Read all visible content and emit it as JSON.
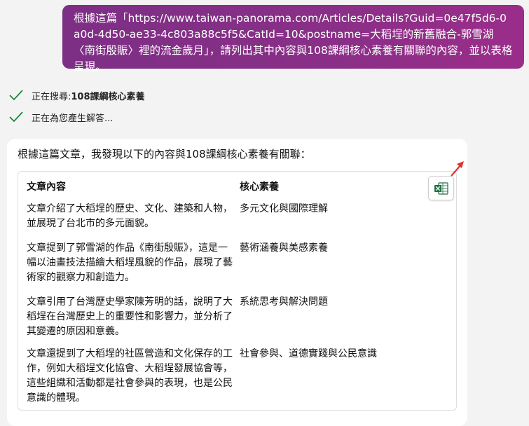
{
  "user_message": "根據這篇「https://www.taiwan-panorama.com/Articles/Details?Guid=0e47f5d6-0a0d-4d50-ae33-4c803a88c5f5&CatId=10&postname=大稻埕的新舊融合-郭雪湖〈南街殷賑〉裡的流金歲月」，請列出其中內容與108課綱核心素養有關聯的內容，並以表格呈現。",
  "status": {
    "searching_prefix": "正在搜尋: ",
    "searching_query": "108課綱核心素養",
    "generating": "正在為您產生解答..."
  },
  "response": {
    "intro": "根據這篇文章，我發現以下的內容與108課綱核心素養有關聯：",
    "table": {
      "headers": [
        "文章內容",
        "核心素養"
      ],
      "rows": [
        {
          "content": "文章介紹了大稻埕的歷史、文化、建築和人物，並展現了台北市的多元面貌。",
          "literacy": "多元文化與國際理解"
        },
        {
          "content": "文章提到了郭雪湖的作品《南街殷賑》，這是一幅以油畫技法描繪大稻埕風貌的作品，展現了藝術家的觀察力和創造力。",
          "literacy": "藝術涵養與美感素養"
        },
        {
          "content": "文章引用了台灣歷史學家陳芳明的話，說明了大稻埕在台灣歷史上的重要性和影響力，並分析了其變遷的原因和意義。",
          "literacy": "系統思考與解決問題"
        },
        {
          "content": "文章還提到了大稻埕的社區營造和文化保存的工作，例如大稻埕文化協會、大稻埕發展協會等，這些組織和活動都是社會參與的表現，也是公民意識的體現。",
          "literacy": "社會參與、道德實踐與公民意識"
        }
      ]
    },
    "export_icon": "excel-icon"
  },
  "colors": {
    "user_bubble": "#8a2f87",
    "check": "#1a8a3a",
    "arrow": "#e0312f",
    "excel": "#1d6f42"
  }
}
